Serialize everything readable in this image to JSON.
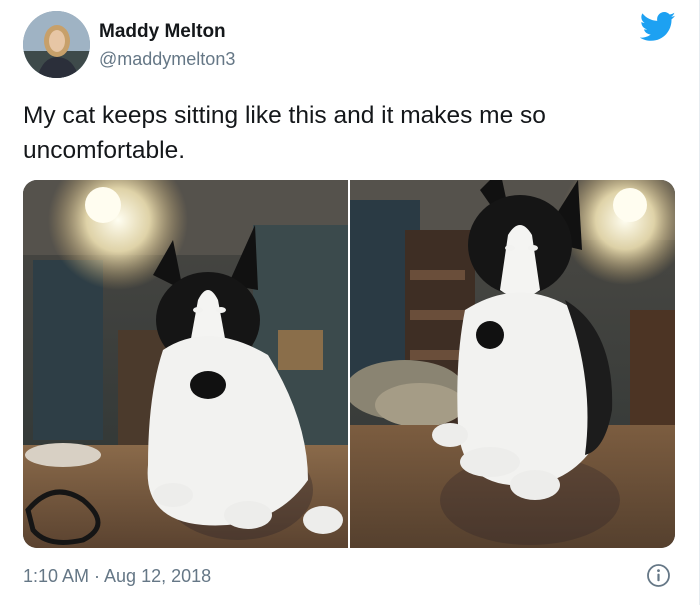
{
  "author": {
    "name": "Maddy Melton",
    "handle": "@maddymelton3"
  },
  "tweet": {
    "text": "My cat keeps sitting like this and it makes me so uncomfortable.",
    "timestamp": "1:10 AM · Aug 12, 2018"
  },
  "icons": {
    "brand": "twitter-bird-icon",
    "info": "info-icon"
  },
  "colors": {
    "brand_blue": "#1da1f2",
    "secondary_text": "#657786",
    "primary_text": "#14171a"
  }
}
